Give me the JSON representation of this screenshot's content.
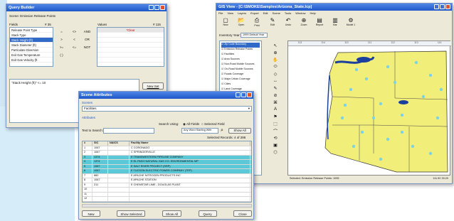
{
  "query_builder": {
    "title": "Query Builder",
    "scene_label": "Scene: Emission Release Points",
    "fields_header": "Fields",
    "fields_count": "# 35",
    "fields": [
      "Release Point Type",
      "Stack Type",
      "Stack Height (ft)",
      "Stack Diameter (ft)",
      "Particulate Diversion",
      "Exit Gas Temperature",
      "Exit Gas Velocity (ft"
    ],
    "selected_field_index": 2,
    "operators": [
      [
        "=",
        "<>",
        "AND"
      ],
      [
        ">",
        "<",
        "OR"
      ],
      [
        ">=",
        "<=",
        "NOT"
      ],
      [
        "( )",
        "",
        ""
      ]
    ],
    "values_header": "Values",
    "values_count": "# 115",
    "values": [
      "*Clear",
      "",
      "",
      "",
      "",
      "",
      ""
    ],
    "query_text": "\"Stack Height (ft)\" <= 10",
    "new_set_label": "New Set"
  },
  "scene_attributes": {
    "title": "Scene Attributes",
    "scene_label": "Scenes",
    "scene_value": "Facilities",
    "attrs_label": "Attributes",
    "search_using_label": "Search Using:",
    "all_fields_label": "All Fields",
    "selected_field_label": "Selected Field",
    "text_search_label": "Text to Search:",
    "match_value": "Any Word Starting With",
    "show_all_label": "Show All",
    "selected_records": "Selected Records: 4 of 286",
    "columns": [
      "#",
      "SIC",
      "NAICS",
      "Facility Name"
    ],
    "rows": [
      {
        "n": "1",
        "sic": "1067",
        "naics": "",
        "name": "C CORONADO",
        "sel": false
      },
      {
        "n": "2",
        "sic": "1067",
        "naics": "",
        "name": "C SPRINGERVILLE",
        "sel": false
      },
      {
        "n": "3",
        "sic": "1374",
        "naics": "",
        "name": "E TRANSWESTERN PIPELINE COMPANY",
        "sel": true
      },
      {
        "n": "4",
        "sic": "1374",
        "naics": "",
        "name": "E EL PASO NATURAL GAS CO. ENVIRONMENTAL MP",
        "sel": true
      },
      {
        "n": "5",
        "sic": "1067",
        "naics": "",
        "name": "E SALT RIVER PROJECT (SRP)",
        "sel": true
      },
      {
        "n": "6",
        "sic": "1067",
        "naics": "",
        "name": "E TUCSON ELECTRIC POWER COMPANY (TEP)",
        "sel": true
      },
      {
        "n": "7",
        "sic": "880",
        "naics": "",
        "name": "E APACHE NITROGEN PRODUCTS INC",
        "sel": false
      },
      {
        "n": "8",
        "sic": "1067",
        "naics": "",
        "name": "E APACHE STATION",
        "sel": false
      },
      {
        "n": "9",
        "sic": "211",
        "naics": "",
        "name": "E CHEMSTAR LIME - DOUGLAS PLANT",
        "sel": false
      },
      {
        "n": "10",
        "sic": "",
        "naics": "",
        "name": "",
        "sel": false
      },
      {
        "n": "11",
        "sic": "",
        "naics": "",
        "name": "",
        "sel": false
      },
      {
        "n": "12",
        "sic": "",
        "naics": "",
        "name": "",
        "sel": false
      }
    ],
    "buttons": [
      "New",
      "Show Selected",
      "Show All",
      "Query",
      "Close"
    ]
  },
  "gis_view": {
    "title": "GIS View - [C:\\SMOKE\\Samples\\Arizona_State.lcp]",
    "menu": [
      "File",
      "View",
      "Layers",
      "Export",
      "Edit",
      "Scene",
      "Tools",
      "Window",
      "Help"
    ],
    "toolbar_labels": [
      "New",
      "Open",
      "Print",
      "Edit",
      "Undo",
      "Zoom",
      "Report",
      "Bar",
      "Model 1"
    ],
    "inventory_label": "Inventory Year:",
    "inventory_value": "1999 Default Year",
    "layers": [
      "Zip Code Boundary",
      "Emission Release Points",
      "Facilities",
      "Area Sources",
      "Non-Road Mobile Sources",
      "On-Road Mobile Sources",
      "Roads Coverage",
      "Major Urban Coverage",
      "Cities",
      "Land Coverage"
    ],
    "ruler": [
      "113",
      "114",
      "110",
      "111",
      "112",
      "113",
      "114"
    ],
    "status_left": "Selected: Emission Release Points: 1095",
    "status_right": "111.92",
    "status_y": "33.20"
  },
  "colors": {
    "titlebar": "#2a62d0",
    "selection": "#3169c6",
    "grid_selection": "#5ac8d6",
    "map_land": "#f2ee7a",
    "map_water": "#1a3f9e",
    "map_points": "#7dd3e0"
  }
}
